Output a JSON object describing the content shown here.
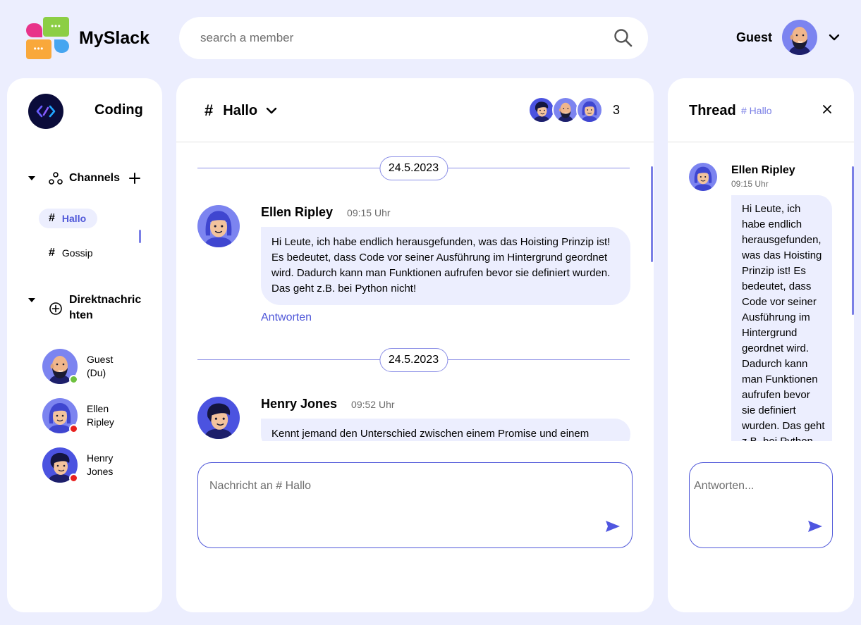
{
  "app": {
    "name": "MySlack"
  },
  "search": {
    "placeholder": "search a member"
  },
  "user": {
    "name": "Guest"
  },
  "workspace": {
    "name": "Coding"
  },
  "sidebar": {
    "channels_label": "Channels",
    "channels": [
      {
        "hash": "#",
        "name": "Hallo",
        "active": true
      },
      {
        "hash": "#",
        "name": "Gossip",
        "active": false
      }
    ],
    "dm_label": "Direktnachrichten",
    "dms": [
      {
        "name": "Guest (Du)",
        "status": "online",
        "status_color": "#6ec13f"
      },
      {
        "name": "Ellen Ripley",
        "status": "offline",
        "status_color": "#e8201e"
      },
      {
        "name": "Henry Jones",
        "status": "offline",
        "status_color": "#e8201e"
      }
    ]
  },
  "channel": {
    "hash": "#",
    "name": "Hallo",
    "member_count": "3",
    "messages": [
      {
        "date": "24.5.2023",
        "author": "Ellen Ripley",
        "time": "09:15 Uhr",
        "text": "Hi Leute, ich habe endlich herausgefunden, was das Hoisting Prinzip ist! Es bedeutet, dass Code vor seiner Ausführung im Hintergrund geordnet wird. Dadurch kann man Funktionen aufrufen bevor sie definiert wurden. Das geht z.B. bei Python nicht!",
        "reply_label": "Antworten"
      },
      {
        "date": "24.5.2023",
        "author": "Henry Jones",
        "time": "09:52 Uhr",
        "text": "Kennt jemand den Unterschied zwischen einem Promise und einem"
      }
    ],
    "composer_placeholder": "Nachricht an # Hallo"
  },
  "thread": {
    "title": "Thread",
    "channel_ref": "# Hallo",
    "message": {
      "author": "Ellen Ripley",
      "time": "09:15 Uhr",
      "text": "Hi Leute, ich habe endlich herausgefunden, was das Hoisting Prinzip ist! Es bedeutet, dass Code vor seiner Ausführung im Hintergrund geordnet wird. Dadurch kann man Funktionen aufrufen bevor sie definiert wurden. Das geht z.B. bei Python nicht!"
    },
    "reply_placeholder": "Antworten..."
  },
  "colors": {
    "background": "#eceefe",
    "accent": "#5159d9",
    "bubble": "#eceefe",
    "workspace_icon": "#0b0c3a"
  },
  "icons": {
    "search": "search-icon",
    "chevron": "chevron-down-icon",
    "close": "close-icon",
    "send": "send-icon",
    "channels": "channels-icon",
    "add_dm": "add-circle-icon",
    "add_channel": "plus-icon"
  }
}
